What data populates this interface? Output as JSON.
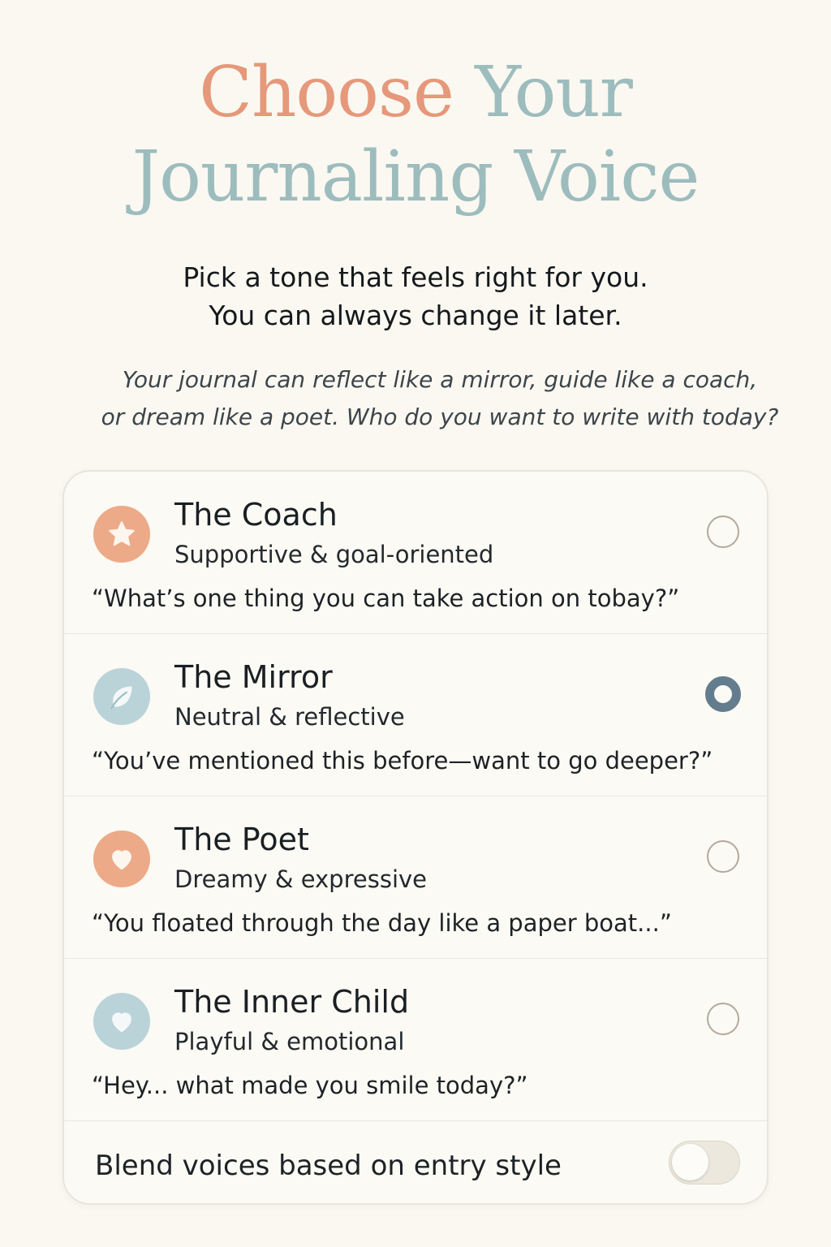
{
  "header": {
    "title_word1": "Choose",
    "title_word2": "Your",
    "title_line2": "Journaling Voice",
    "subtitle_line1": "Pick a tone that feels right for you.",
    "subtitle_line2": "You can always change it later.",
    "intro_line1": "Your journal can reflect like a mirror, guide like a coach,",
    "intro_line2": "or dream like a poet. Who do you want to write with today?"
  },
  "voices": [
    {
      "name": "The Coach",
      "description": "Supportive & goal-oriented",
      "quote": "“What’s one thing you can take action on tobay?”",
      "icon": "star-icon",
      "icon_color": "#ecaa88",
      "selected": false
    },
    {
      "name": "The Mirror",
      "description": "Neutral & reflective",
      "quote": "“You’ve mentioned this before—want to go deeper?”",
      "icon": "leaf-icon",
      "icon_color": "#bad3d9",
      "selected": true
    },
    {
      "name": "The Poet",
      "description": "Dreamy & expressive",
      "quote": "“You floated through the day like a paper boat...”",
      "icon": "heart-icon",
      "icon_color": "#ecaa88",
      "selected": false
    },
    {
      "name": "The Inner Child",
      "description": "Playful & emotional",
      "quote": "“Hey... what made you smile today?”",
      "icon": "heart-icon",
      "icon_color": "#bad3d9",
      "selected": false
    }
  ],
  "blend": {
    "label": "Blend voices based on entry style",
    "enabled": false
  },
  "colors": {
    "accent_peach": "#e6987a",
    "accent_sage": "#9dbcbd",
    "selected_radio": "#637d8e",
    "background": "#faf8f1"
  }
}
